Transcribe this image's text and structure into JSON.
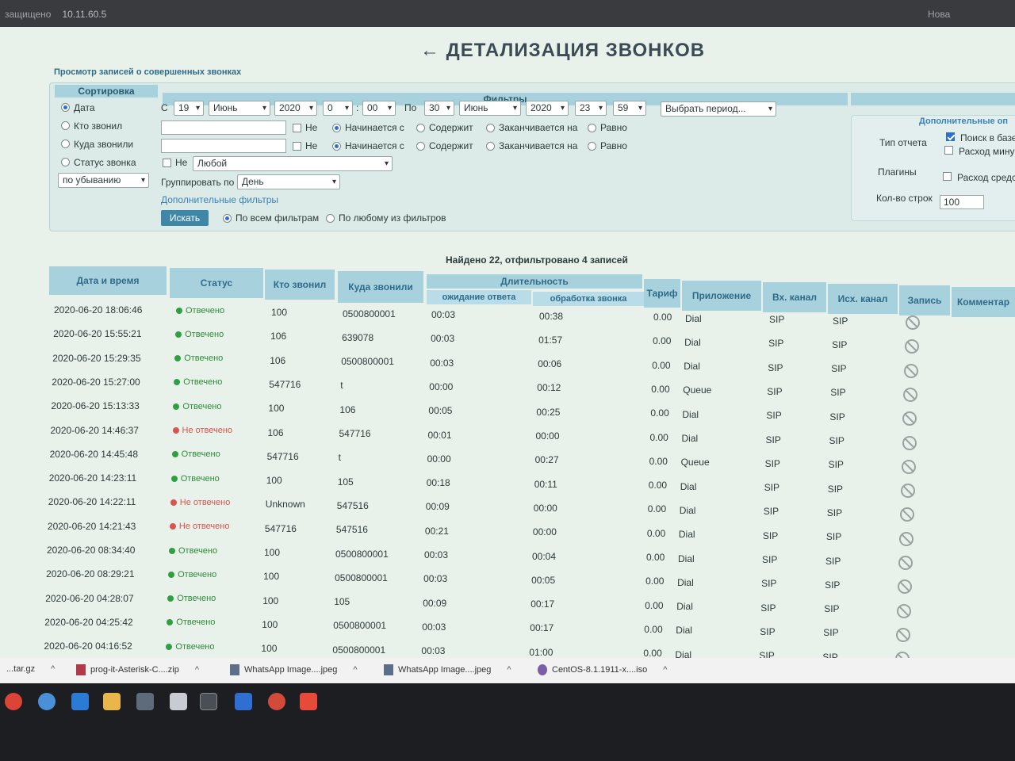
{
  "browser": {
    "security_label": "защищено",
    "address": "10.11.60.5",
    "tab_labels": [
      "Нова"
    ]
  },
  "page": {
    "title": "Детализация звонков",
    "subtitle": "Просмотр записей о совершенных звонках",
    "found_text": "Найдено 22, отфильтровано 4 записей"
  },
  "sort": {
    "header": "Сортировка",
    "options": [
      "Дата",
      "Кто звонил",
      "Куда звонили",
      "Статус звонка"
    ],
    "selected": 0,
    "order": "по убыванию"
  },
  "filters": {
    "header": "Фильтры",
    "from_label": "С",
    "to_label": "По",
    "from": {
      "day": "19",
      "month": "Июнь",
      "year": "2020",
      "hour": "0",
      "minute": "00"
    },
    "to": {
      "day": "30",
      "month": "Июнь",
      "year": "2020",
      "hour": "23",
      "minute": "59"
    },
    "time_sep": ":",
    "period_placeholder": "Выбрать период...",
    "not_label": "Не",
    "match_options": [
      "Начинается с",
      "Содержит",
      "Заканчивается на",
      "Равно"
    ],
    "status_value": "Любой",
    "group_label": "Группировать по",
    "group_value": "День",
    "extra_filters_link": "Дополнительные фильтры",
    "search_button": "Искать",
    "logic_options": [
      "По всем фильтрам",
      "По любому из фильтров"
    ]
  },
  "extra": {
    "header": "Дополнительные оп",
    "report_type_label": "Тип отчета",
    "plugins_label": "Плагины",
    "rows_label": "Кол-во строк",
    "rows_value": "100",
    "checks": [
      "Поиск в базе",
      "Расход мину",
      "Расход средс"
    ]
  },
  "table": {
    "headers": {
      "datetime": "Дата и время",
      "status": "Статус",
      "src": "Кто звонил",
      "dst": "Куда звонили",
      "duration": "Длительность",
      "wait": "ожидание ответа",
      "talk": "обработка звонка",
      "tariff": "Тариф",
      "app": "Приложение",
      "in_ch": "Вх. канал",
      "out_ch": "Исх. канал",
      "record": "Запись",
      "comment": "Комментар"
    },
    "rows": [
      {
        "dt": "2020-06-20 18:06:46",
        "st": "Отвечено",
        "ok": true,
        "src": "100",
        "dst": "0500800001",
        "wait": "00:03",
        "talk": "00:38",
        "tariff": "0.00",
        "app": "Dial",
        "in": "SIP",
        "out": "SIP"
      },
      {
        "dt": "2020-06-20 15:55:21",
        "st": "Отвечено",
        "ok": true,
        "src": "106",
        "dst": "639078",
        "wait": "00:03",
        "talk": "01:57",
        "tariff": "0.00",
        "app": "Dial",
        "in": "SIP",
        "out": "SIP"
      },
      {
        "dt": "2020-06-20 15:29:35",
        "st": "Отвечено",
        "ok": true,
        "src": "106",
        "dst": "0500800001",
        "wait": "00:03",
        "talk": "00:06",
        "tariff": "0.00",
        "app": "Dial",
        "in": "SIP",
        "out": "SIP"
      },
      {
        "dt": "2020-06-20 15:27:00",
        "st": "Отвечено",
        "ok": true,
        "src": "547716",
        "dst": "t",
        "wait": "00:00",
        "talk": "00:12",
        "tariff": "0.00",
        "app": "Queue",
        "in": "SIP",
        "out": "SIP"
      },
      {
        "dt": "2020-06-20 15:13:33",
        "st": "Отвечено",
        "ok": true,
        "src": "100",
        "dst": "106",
        "wait": "00:05",
        "talk": "00:25",
        "tariff": "0.00",
        "app": "Dial",
        "in": "SIP",
        "out": "SIP"
      },
      {
        "dt": "2020-06-20 14:46:37",
        "st": "Не отвечено",
        "ok": false,
        "src": "106",
        "dst": "547716",
        "wait": "00:01",
        "talk": "00:00",
        "tariff": "0.00",
        "app": "Dial",
        "in": "SIP",
        "out": "SIP"
      },
      {
        "dt": "2020-06-20 14:45:48",
        "st": "Отвечено",
        "ok": true,
        "src": "547716",
        "dst": "t",
        "wait": "00:00",
        "talk": "00:27",
        "tariff": "0.00",
        "app": "Queue",
        "in": "SIP",
        "out": "SIP"
      },
      {
        "dt": "2020-06-20 14:23:11",
        "st": "Отвечено",
        "ok": true,
        "src": "100",
        "dst": "105",
        "wait": "00:18",
        "talk": "00:11",
        "tariff": "0.00",
        "app": "Dial",
        "in": "SIP",
        "out": "SIP"
      },
      {
        "dt": "2020-06-20 14:22:11",
        "st": "Не отвечено",
        "ok": false,
        "src": "Unknown",
        "dst": "547516",
        "wait": "00:09",
        "talk": "00:00",
        "tariff": "0.00",
        "app": "Dial",
        "in": "SIP",
        "out": "SIP"
      },
      {
        "dt": "2020-06-20 14:21:43",
        "st": "Не отвечено",
        "ok": false,
        "src": "547716",
        "dst": "547516",
        "wait": "00:21",
        "talk": "00:00",
        "tariff": "0.00",
        "app": "Dial",
        "in": "SIP",
        "out": "SIP"
      },
      {
        "dt": "2020-06-20 08:34:40",
        "st": "Отвечено",
        "ok": true,
        "src": "100",
        "dst": "0500800001",
        "wait": "00:03",
        "talk": "00:04",
        "tariff": "0.00",
        "app": "Dial",
        "in": "SIP",
        "out": "SIP"
      },
      {
        "dt": "2020-06-20 08:29:21",
        "st": "Отвечено",
        "ok": true,
        "src": "100",
        "dst": "0500800001",
        "wait": "00:03",
        "talk": "00:05",
        "tariff": "0.00",
        "app": "Dial",
        "in": "SIP",
        "out": "SIP"
      },
      {
        "dt": "2020-06-20 04:28:07",
        "st": "Отвечено",
        "ok": true,
        "src": "100",
        "dst": "105",
        "wait": "00:09",
        "talk": "00:17",
        "tariff": "0.00",
        "app": "Dial",
        "in": "SIP",
        "out": "SIP"
      },
      {
        "dt": "2020-06-20 04:25:42",
        "st": "Отвечено",
        "ok": true,
        "src": "100",
        "dst": "0500800001",
        "wait": "00:03",
        "talk": "00:17",
        "tariff": "0.00",
        "app": "Dial",
        "in": "SIP",
        "out": "SIP"
      },
      {
        "dt": "2020-06-20 04:16:52",
        "st": "Отвечено",
        "ok": true,
        "src": "100",
        "dst": "0500800001",
        "wait": "00:03",
        "talk": "01:00",
        "tariff": "0.00",
        "app": "Dial",
        "in": "SIP",
        "out": "SIP"
      }
    ]
  },
  "downloads": [
    {
      "name": "...tar.gz"
    },
    {
      "name": "prog-it-Asterisk-C....zip"
    },
    {
      "name": "WhatsApp Image....jpeg"
    },
    {
      "name": "WhatsApp Image....jpeg"
    },
    {
      "name": "CentOS-8.1.1911-x....iso"
    }
  ],
  "icons": {
    "record": "no-record-icon",
    "download_chevron": "^"
  }
}
